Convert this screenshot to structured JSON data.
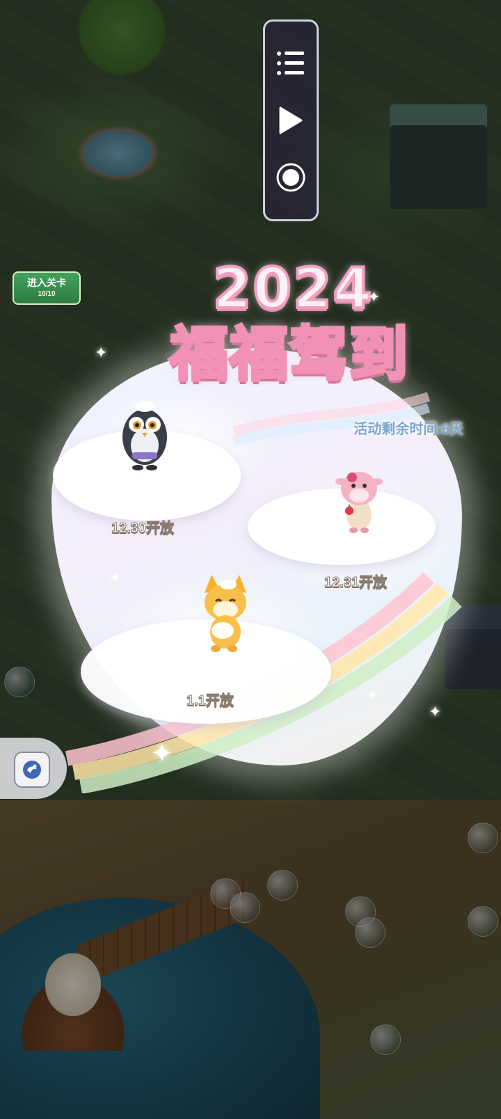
{
  "level_tag": {
    "title": "进入关卡",
    "count": "10/10"
  },
  "media_controls": {
    "items": [
      {
        "name": "playlist-icon"
      },
      {
        "name": "play-icon"
      },
      {
        "name": "record-icon"
      }
    ]
  },
  "event": {
    "title_year": "2024",
    "title_main": "福福驾到",
    "remaining_time": "活动剩余时间:6天",
    "stages": [
      {
        "character": "penguin",
        "label": "12.30开放"
      },
      {
        "character": "cow",
        "label": "12.31开放"
      },
      {
        "character": "fox",
        "label": "1.1开放"
      }
    ]
  },
  "colors": {
    "title_stroke": "#f091b5",
    "remain_text": "#7ba6cf",
    "label_stroke": "#8d7c70"
  }
}
